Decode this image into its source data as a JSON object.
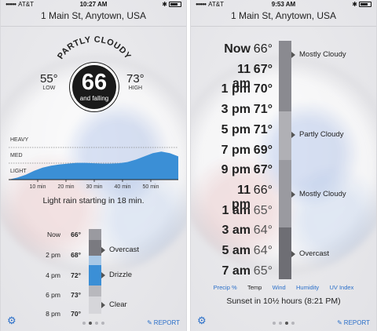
{
  "left": {
    "status": {
      "carrier": "AT&T",
      "time": "10:27 AM"
    },
    "location": "1 Main St, Anytown, USA",
    "condition": "PARTLY CLOUDY",
    "current_temp": "66",
    "trend": "and falling",
    "low": {
      "temp": "55°",
      "label": "LOW"
    },
    "high": {
      "temp": "73°",
      "label": "HIGH"
    },
    "rain_chart": {
      "levels": [
        "HEAVY",
        "MED",
        "LIGHT"
      ],
      "ticks": [
        "10 min",
        "20 min",
        "30 min",
        "40 min",
        "50 min"
      ],
      "intensity": [
        0.0,
        0.05,
        0.12,
        0.22,
        0.3,
        0.35,
        0.38,
        0.4,
        0.42,
        0.42,
        0.41,
        0.4,
        0.4,
        0.41,
        0.44,
        0.5,
        0.58,
        0.66,
        0.7,
        0.66,
        0.58
      ],
      "color": "#3b8fd6"
    },
    "rain_summary": "Light rain starting in 18 min.",
    "hourly": [
      {
        "time": "Now",
        "temp": "66°"
      },
      {
        "time": "2 pm",
        "temp": "68°"
      },
      {
        "time": "4 pm",
        "temp": "72°"
      },
      {
        "time": "6 pm",
        "temp": "73°"
      },
      {
        "time": "8 pm",
        "temp": "70°"
      }
    ],
    "segments": [
      "Overcast",
      "Drizzle",
      "Clear"
    ],
    "report": "REPORT",
    "page": 1
  },
  "right": {
    "status": {
      "carrier": "AT&T",
      "time": "9:53 AM"
    },
    "location": "1 Main St, Anytown, USA",
    "hourly": [
      {
        "time": "Now",
        "temp": "66°"
      },
      {
        "time": "11 am",
        "temp": "67°"
      },
      {
        "time": "1 pm",
        "temp": "70°"
      },
      {
        "time": "3 pm",
        "temp": "71°"
      },
      {
        "time": "5 pm",
        "temp": "71°"
      },
      {
        "time": "7 pm",
        "temp": "69°"
      },
      {
        "time": "9 pm",
        "temp": "67°"
      },
      {
        "time": "11 pm",
        "temp": "66°"
      },
      {
        "time": "1 am",
        "temp": "65°"
      },
      {
        "time": "3 am",
        "temp": "64°"
      },
      {
        "time": "5 am",
        "temp": "64°"
      },
      {
        "time": "7 am",
        "temp": "65°"
      }
    ],
    "segments": [
      "Mostly Cloudy",
      "Partly Cloudy",
      "Mostly Cloudy",
      "Overcast"
    ],
    "tabs": [
      "Precip %",
      "Temp",
      "Wind",
      "Humidity",
      "UV Index"
    ],
    "active_tab": "Temp",
    "sunset": "Sunset in 10½ hours (8:21 PM)",
    "report": "REPORT",
    "page": 2
  },
  "colors": {
    "accent": "#2a6fc9",
    "rain": "#3b8fd6",
    "dark_circle": "#1a1a1a"
  }
}
